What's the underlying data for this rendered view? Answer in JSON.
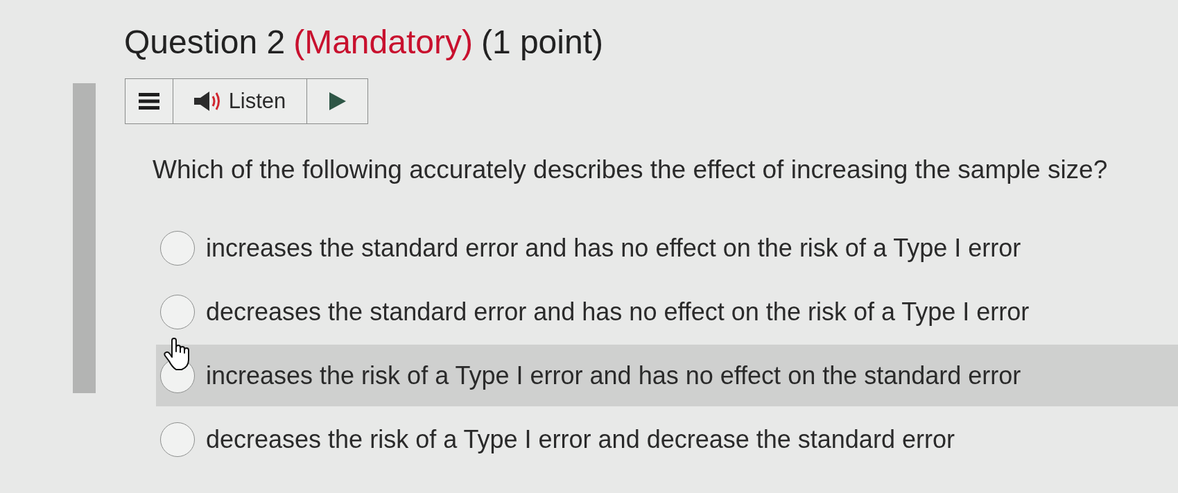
{
  "question": {
    "number": "Question 2",
    "mandatory": "(Mandatory)",
    "points": "(1 point)"
  },
  "toolbar": {
    "listen": "Listen"
  },
  "prompt": "Which of the following accurately describes the effect of increasing the sample size?",
  "options": [
    {
      "label": "increases the standard error and has no effect on the risk of a Type I error",
      "selected": false,
      "hovered": false
    },
    {
      "label": "decreases the standard error and has no effect on the risk of a Type I error",
      "selected": false,
      "hovered": false
    },
    {
      "label": "increases the risk of a Type I error and has no effect on the standard error",
      "selected": false,
      "hovered": true
    },
    {
      "label": "decreases the risk of a Type I error and decrease the standard error",
      "selected": false,
      "hovered": false
    }
  ]
}
